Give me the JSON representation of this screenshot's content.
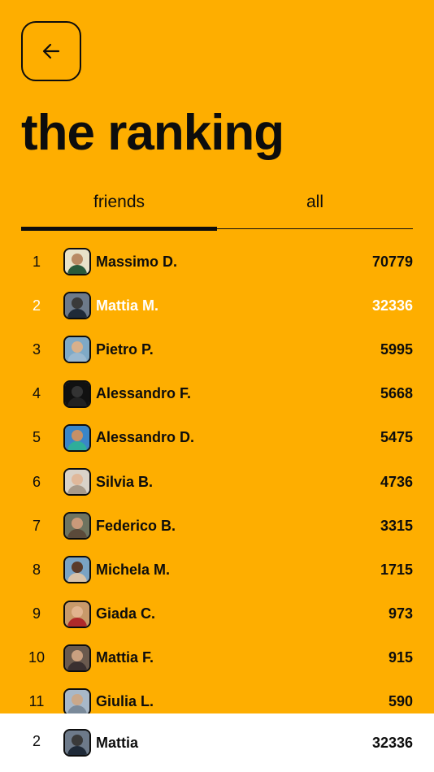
{
  "header": {
    "back_icon": "arrow-left-icon",
    "title": "the ranking"
  },
  "tabs": [
    {
      "label": "friends",
      "active": true
    },
    {
      "label": "all",
      "active": false
    }
  ],
  "colors": {
    "background": "#FEAE00",
    "text": "#0d0d0d",
    "highlight_text": "#ffffff",
    "footer_background": "#ffffff"
  },
  "ranking": [
    {
      "rank": "1",
      "name": "Massimo D.",
      "score": "70779",
      "avatar": {
        "bg": "#e8e2c9",
        "head": "#b88a64",
        "body": "#2a5a3a"
      }
    },
    {
      "rank": "2",
      "name": "Mattia M.",
      "score": "32336",
      "highlight": true,
      "avatar": {
        "bg": "#6d7a8a",
        "head": "#3a3a3a",
        "body": "#1f2a38"
      }
    },
    {
      "rank": "3",
      "name": "Pietro P.",
      "score": "5995",
      "avatar": {
        "bg": "#7fa9c6",
        "head": "#d8b08c",
        "body": "#9ab8cf"
      }
    },
    {
      "rank": "4",
      "name": "Alessandro F.",
      "score": "5668",
      "avatar": {
        "bg": "#111111",
        "head": "#333333",
        "body": "#222222"
      }
    },
    {
      "rank": "5",
      "name": "Alessandro D.",
      "score": "5475",
      "avatar": {
        "bg": "#3a86c8",
        "head": "#c79066",
        "body": "#2fae9a"
      }
    },
    {
      "rank": "6",
      "name": "Silvia B.",
      "score": "4736",
      "avatar": {
        "bg": "#d9d2c8",
        "head": "#e0b89a",
        "body": "#a89a8a"
      }
    },
    {
      "rank": "7",
      "name": "Federico B.",
      "score": "3315",
      "avatar": {
        "bg": "#6f7460",
        "head": "#c99a7a",
        "body": "#5b4a3a"
      }
    },
    {
      "rank": "8",
      "name": "Michela M.",
      "score": "1715",
      "avatar": {
        "bg": "#7aa3c4",
        "head": "#5a3a2a",
        "body": "#d8c2a8"
      }
    },
    {
      "rank": "9",
      "name": "Giada C.",
      "score": "973",
      "avatar": {
        "bg": "#c89a6a",
        "head": "#e1b48e",
        "body": "#b02a2a"
      }
    },
    {
      "rank": "10",
      "name": "Mattia F.",
      "score": "915",
      "avatar": {
        "bg": "#6a5a4e",
        "head": "#caa080",
        "body": "#3a3030"
      }
    },
    {
      "rank": "11",
      "name": "Giulia L.",
      "score": "590",
      "avatar": {
        "bg": "#a8b8c8",
        "head": "#caa88a",
        "body": "#7a8a9a"
      }
    }
  ],
  "current_user": {
    "rank": "2",
    "name": "Mattia",
    "score": "32336",
    "avatar": {
      "bg": "#6d7a8a",
      "head": "#3a3a3a",
      "body": "#1f2a38"
    }
  }
}
